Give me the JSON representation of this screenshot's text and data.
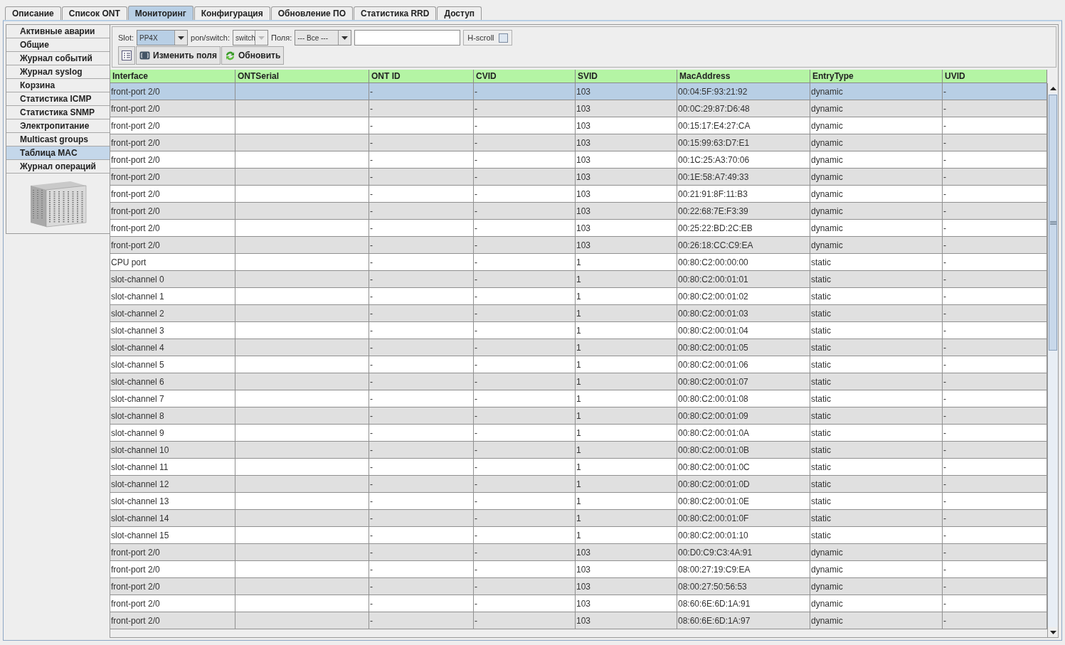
{
  "tabs": [
    {
      "label": "Описание",
      "selected": false
    },
    {
      "label": "Список ONT",
      "selected": false
    },
    {
      "label": "Мониторинг",
      "selected": true
    },
    {
      "label": "Конфигурация",
      "selected": false
    },
    {
      "label": "Обновление ПО",
      "selected": false
    },
    {
      "label": "Статистика RRD",
      "selected": false
    },
    {
      "label": "Доступ",
      "selected": false
    }
  ],
  "sidebar": {
    "items": [
      {
        "label": "Активные аварии",
        "selected": false
      },
      {
        "label": "Общие",
        "selected": false
      },
      {
        "label": "Журнал событий",
        "selected": false
      },
      {
        "label": "Журнал syslog",
        "selected": false
      },
      {
        "label": "Корзина",
        "selected": false
      },
      {
        "label": "Статистика ICMP",
        "selected": false
      },
      {
        "label": "Статистика SNMP",
        "selected": false
      },
      {
        "label": "Электропитание",
        "selected": false
      },
      {
        "label": "Multicast groups",
        "selected": false
      },
      {
        "label": "Таблица MAC",
        "selected": true
      },
      {
        "label": "Журнал операций",
        "selected": false
      }
    ]
  },
  "filters": {
    "slot": {
      "label": "Slot:",
      "value": "PP4X",
      "disabled": false
    },
    "pon_switch": {
      "label": "pon/switch:",
      "value": "switch",
      "disabled": true
    },
    "fields": {
      "label": "Поля:",
      "value": "--- Все ---",
      "disabled": false
    },
    "hscroll": {
      "label": "H-scroll",
      "checked": false
    }
  },
  "buttons": [
    {
      "kind": "icon"
    },
    {
      "kind": "fields",
      "label": "Изменить поля"
    },
    {
      "kind": "refresh",
      "label": "Обновить"
    }
  ],
  "table": {
    "columns": [
      "Interface",
      "ONTSerial",
      "ONT ID",
      "CVID",
      "SVID",
      "MacAddress",
      "EntryType",
      "UVID"
    ],
    "rows": [
      {
        "selected": true,
        "cells": [
          "front-port 2/0",
          "",
          "-",
          "-",
          "103",
          "00:04:5F:93:21:92",
          "dynamic",
          "-"
        ]
      },
      {
        "selected": false,
        "cells": [
          "front-port 2/0",
          "",
          "-",
          "-",
          "103",
          "00:0C:29:87:D6:48",
          "dynamic",
          "-"
        ]
      },
      {
        "selected": false,
        "cells": [
          "front-port 2/0",
          "",
          "-",
          "-",
          "103",
          "00:15:17:E4:27:CA",
          "dynamic",
          "-"
        ]
      },
      {
        "selected": false,
        "cells": [
          "front-port 2/0",
          "",
          "-",
          "-",
          "103",
          "00:15:99:63:D7:E1",
          "dynamic",
          "-"
        ]
      },
      {
        "selected": false,
        "cells": [
          "front-port 2/0",
          "",
          "-",
          "-",
          "103",
          "00:1C:25:A3:70:06",
          "dynamic",
          "-"
        ]
      },
      {
        "selected": false,
        "cells": [
          "front-port 2/0",
          "",
          "-",
          "-",
          "103",
          "00:1E:58:A7:49:33",
          "dynamic",
          "-"
        ]
      },
      {
        "selected": false,
        "cells": [
          "front-port 2/0",
          "",
          "-",
          "-",
          "103",
          "00:21:91:8F:11:B3",
          "dynamic",
          "-"
        ]
      },
      {
        "selected": false,
        "cells": [
          "front-port 2/0",
          "",
          "-",
          "-",
          "103",
          "00:22:68:7E:F3:39",
          "dynamic",
          "-"
        ]
      },
      {
        "selected": false,
        "cells": [
          "front-port 2/0",
          "",
          "-",
          "-",
          "103",
          "00:25:22:BD:2C:EB",
          "dynamic",
          "-"
        ]
      },
      {
        "selected": false,
        "cells": [
          "front-port 2/0",
          "",
          "-",
          "-",
          "103",
          "00:26:18:CC:C9:EA",
          "dynamic",
          "-"
        ]
      },
      {
        "selected": false,
        "cells": [
          "CPU port",
          "",
          "-",
          "-",
          "1",
          "00:80:C2:00:00:00",
          "static",
          "-"
        ]
      },
      {
        "selected": false,
        "cells": [
          "slot-channel 0",
          "",
          "-",
          "-",
          "1",
          "00:80:C2:00:01:01",
          "static",
          "-"
        ]
      },
      {
        "selected": false,
        "cells": [
          "slot-channel 1",
          "",
          "-",
          "-",
          "1",
          "00:80:C2:00:01:02",
          "static",
          "-"
        ]
      },
      {
        "selected": false,
        "cells": [
          "slot-channel 2",
          "",
          "-",
          "-",
          "1",
          "00:80:C2:00:01:03",
          "static",
          "-"
        ]
      },
      {
        "selected": false,
        "cells": [
          "slot-channel 3",
          "",
          "-",
          "-",
          "1",
          "00:80:C2:00:01:04",
          "static",
          "-"
        ]
      },
      {
        "selected": false,
        "cells": [
          "slot-channel 4",
          "",
          "-",
          "-",
          "1",
          "00:80:C2:00:01:05",
          "static",
          "-"
        ]
      },
      {
        "selected": false,
        "cells": [
          "slot-channel 5",
          "",
          "-",
          "-",
          "1",
          "00:80:C2:00:01:06",
          "static",
          "-"
        ]
      },
      {
        "selected": false,
        "cells": [
          "slot-channel 6",
          "",
          "-",
          "-",
          "1",
          "00:80:C2:00:01:07",
          "static",
          "-"
        ]
      },
      {
        "selected": false,
        "cells": [
          "slot-channel 7",
          "",
          "-",
          "-",
          "1",
          "00:80:C2:00:01:08",
          "static",
          "-"
        ]
      },
      {
        "selected": false,
        "cells": [
          "slot-channel 8",
          "",
          "-",
          "-",
          "1",
          "00:80:C2:00:01:09",
          "static",
          "-"
        ]
      },
      {
        "selected": false,
        "cells": [
          "slot-channel 9",
          "",
          "-",
          "-",
          "1",
          "00:80:C2:00:01:0A",
          "static",
          "-"
        ]
      },
      {
        "selected": false,
        "cells": [
          "slot-channel 10",
          "",
          "-",
          "-",
          "1",
          "00:80:C2:00:01:0B",
          "static",
          "-"
        ]
      },
      {
        "selected": false,
        "cells": [
          "slot-channel 11",
          "",
          "-",
          "-",
          "1",
          "00:80:C2:00:01:0C",
          "static",
          "-"
        ]
      },
      {
        "selected": false,
        "cells": [
          "slot-channel 12",
          "",
          "-",
          "-",
          "1",
          "00:80:C2:00:01:0D",
          "static",
          "-"
        ]
      },
      {
        "selected": false,
        "cells": [
          "slot-channel 13",
          "",
          "-",
          "-",
          "1",
          "00:80:C2:00:01:0E",
          "static",
          "-"
        ]
      },
      {
        "selected": false,
        "cells": [
          "slot-channel 14",
          "",
          "-",
          "-",
          "1",
          "00:80:C2:00:01:0F",
          "static",
          "-"
        ]
      },
      {
        "selected": false,
        "cells": [
          "slot-channel 15",
          "",
          "-",
          "-",
          "1",
          "00:80:C2:00:01:10",
          "static",
          "-"
        ]
      },
      {
        "selected": false,
        "cells": [
          "front-port 2/0",
          "",
          "-",
          "-",
          "103",
          "00:D0:C9:C3:4A:91",
          "dynamic",
          "-"
        ]
      },
      {
        "selected": false,
        "cells": [
          "front-port 2/0",
          "",
          "-",
          "-",
          "103",
          "08:00:27:19:C9:EA",
          "dynamic",
          "-"
        ]
      },
      {
        "selected": false,
        "cells": [
          "front-port 2/0",
          "",
          "-",
          "-",
          "103",
          "08:00:27:50:56:53",
          "dynamic",
          "-"
        ]
      },
      {
        "selected": false,
        "cells": [
          "front-port 2/0",
          "",
          "-",
          "-",
          "103",
          "08:60:6E:6D:1A:91",
          "dynamic",
          "-"
        ]
      },
      {
        "selected": false,
        "cells": [
          "front-port 2/0",
          "",
          "-",
          "-",
          "103",
          "08:60:6E:6D:1A:97",
          "dynamic",
          "-"
        ]
      }
    ]
  }
}
